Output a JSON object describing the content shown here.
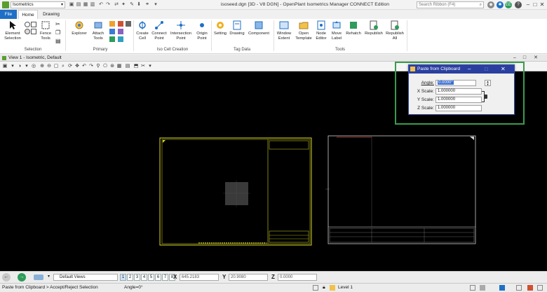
{
  "titlebar": {
    "workflow": "Isometrics",
    "doc_title": "isoseed.dgn [3D - V8 DGN] - OpenPlant Isometrics Manager CONNECT Edition",
    "search_placeholder": "Search Ribbon (F4)",
    "user_initials": "EE"
  },
  "tabs": {
    "file": "File",
    "home": "Home",
    "drawing": "Drawing"
  },
  "ribbon": {
    "selection": {
      "label": "Selection",
      "element_selection": "Element Selection",
      "fence_tools": "Fence Tools"
    },
    "primary": {
      "label": "Primary",
      "explorer": "Explorer",
      "attach_tools": "Attach Tools"
    },
    "iso_cell": {
      "label": "Iso Cell Creation",
      "create_cell": "Create Cell",
      "connect_point": "Connect Point",
      "intersection_point": "Intersection Point",
      "origin_point": "Origin Point"
    },
    "tag_data": {
      "label": "Tag Data",
      "setting": "Setting",
      "drawing": "Drawing",
      "component": "Component"
    },
    "tools": {
      "label": "Tools",
      "window_extent": "Window Extent",
      "open_template": "Open Template",
      "node_editor": "Node Editor",
      "move_label": "Move Label",
      "rehatch": "Rehatch",
      "republish": "Republish",
      "republish_all": "Republish All"
    }
  },
  "view": {
    "title": "View 1 - Isometric, Default"
  },
  "dialog": {
    "title": "Paste from Clipboard",
    "angle_label": "Angle:",
    "angle_value": "0.0000°",
    "xscale_label": "X Scale:",
    "xscale_value": "1.000000",
    "yscale_label": "Y Scale:",
    "yscale_value": "1.000000",
    "zscale_label": "Z Scale:",
    "zscale_value": "1.000000"
  },
  "statusbar": {
    "views_label": "Default Views",
    "view_numbers": [
      "1",
      "2",
      "3",
      "4",
      "5",
      "6",
      "7",
      "8"
    ],
    "x_label": "X",
    "x_value": "645.2183",
    "y_label": "Y",
    "y_value": "20.9080",
    "z_label": "Z",
    "z_value": "0.0000",
    "prompt": "Paste from Clipboard > Accept/Reject Selection",
    "angle_readout": "Angle=0°",
    "level": "Level 1"
  },
  "colors": {
    "accent": "#1e6fc6",
    "dialog_title": "#2b3fa0",
    "highlight_frame": "#3a9c4b",
    "sheet_yellow": "#d7d72a",
    "sheet_white": "#e8e8e8"
  }
}
